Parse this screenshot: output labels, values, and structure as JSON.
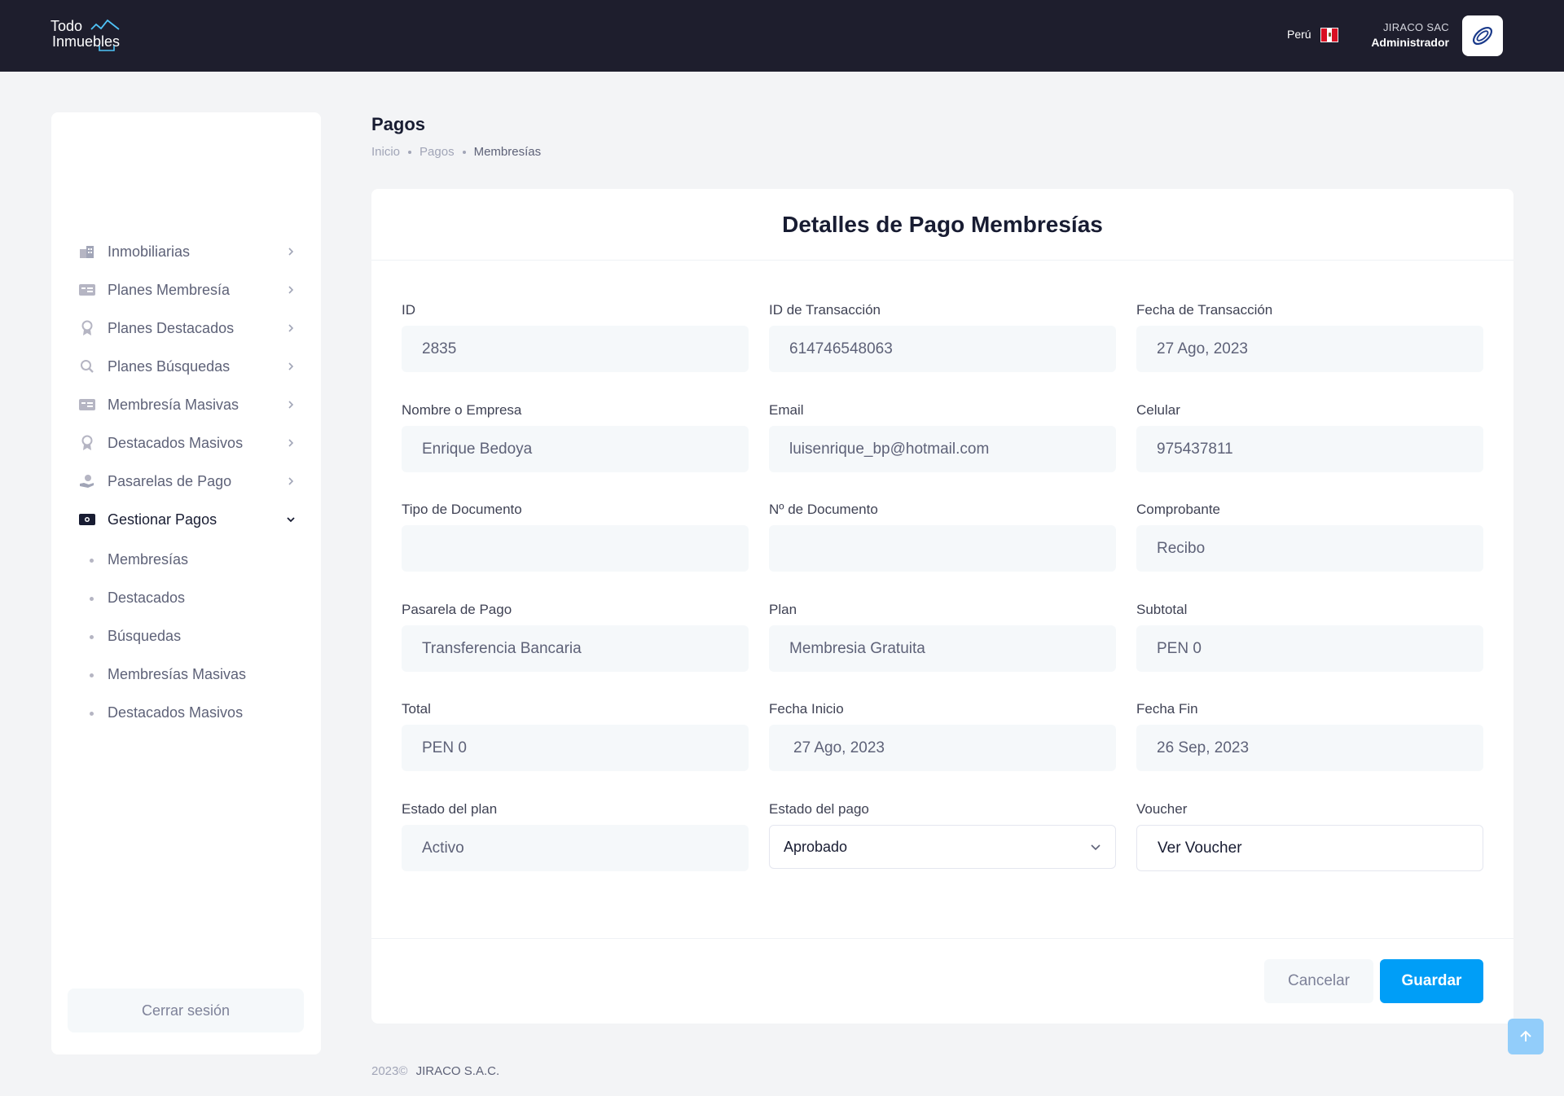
{
  "header": {
    "logo_line1": "Todo",
    "logo_line2": "Inmuebles",
    "country": "Perú",
    "company": "JIRACO SAC",
    "role": "Administrador"
  },
  "sidebar": {
    "items": [
      {
        "label": "Inmobiliarias",
        "icon": "buildings-icon"
      },
      {
        "label": "Planes Membresía",
        "icon": "card-icon"
      },
      {
        "label": "Planes Destacados",
        "icon": "medal-icon"
      },
      {
        "label": "Planes Búsquedas",
        "icon": "search-icon"
      },
      {
        "label": "Membresía Masivas",
        "icon": "card-icon"
      },
      {
        "label": "Destacados Masivos",
        "icon": "medal-icon"
      },
      {
        "label": "Pasarelas de Pago",
        "icon": "hand-coin-icon"
      },
      {
        "label": "Gestionar Pagos",
        "icon": "wallet-icon"
      }
    ],
    "subitems": [
      "Membresías",
      "Destacados",
      "Búsquedas",
      "Membresías Masivas",
      "Destacados Masivos"
    ],
    "logout": "Cerrar sesión"
  },
  "page": {
    "title": "Pagos",
    "breadcrumb": [
      "Inicio",
      "Pagos",
      "Membresías"
    ]
  },
  "form": {
    "title": "Detalles de Pago Membresías",
    "fields": {
      "id": {
        "label": "ID",
        "value": "2835"
      },
      "transaction_id": {
        "label": "ID de Transacción",
        "value": "614746548063"
      },
      "transaction_date": {
        "label": "Fecha de Transacción",
        "value": "27 Ago, 2023"
      },
      "name": {
        "label": "Nombre o Empresa",
        "value": "Enrique Bedoya"
      },
      "email": {
        "label": "Email",
        "value": "luisenrique_bp@hotmail.com"
      },
      "phone": {
        "label": "Celular",
        "value": "975437811"
      },
      "doc_type": {
        "label": "Tipo de Documento",
        "value": ""
      },
      "doc_number": {
        "label": "Nº de Documento",
        "value": ""
      },
      "receipt": {
        "label": "Comprobante",
        "value": "Recibo"
      },
      "gateway": {
        "label": "Pasarela de Pago",
        "value": "Transferencia Bancaria"
      },
      "plan": {
        "label": "Plan",
        "value": "Membresia Gratuita"
      },
      "subtotal": {
        "label": "Subtotal",
        "value": "PEN 0"
      },
      "total": {
        "label": "Total",
        "value": "PEN 0"
      },
      "start_date": {
        "label": "Fecha Inicio",
        "value": "27 Ago, 2023"
      },
      "end_date": {
        "label": "Fecha Fin",
        "value": "26 Sep, 2023"
      },
      "plan_status": {
        "label": "Estado del plan",
        "value": "Activo"
      },
      "payment_status": {
        "label": "Estado del pago",
        "value": "Aprobado"
      },
      "voucher": {
        "label": "Voucher",
        "value": "Ver Voucher"
      }
    },
    "cancel_label": "Cancelar",
    "save_label": "Guardar"
  },
  "footer": {
    "year": "2023©",
    "company": "JIRACO S.A.C."
  },
  "colors": {
    "topbar": "#1e1e2d",
    "primary": "#009ef7",
    "input_bg": "#f5f8fa"
  }
}
